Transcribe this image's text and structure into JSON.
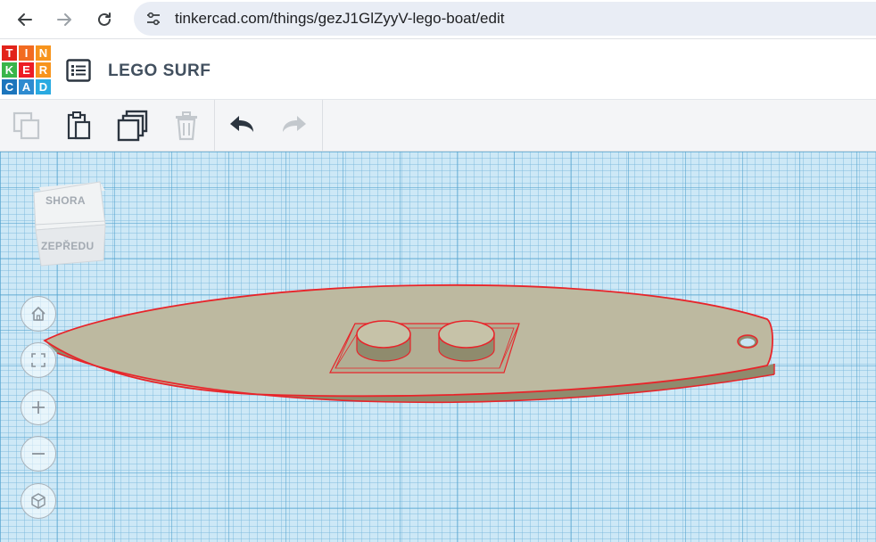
{
  "browser": {
    "url": "tinkercad.com/things/gezJ1GlZyyV-lego-boat/edit",
    "icons": [
      "back-arrow-icon",
      "forward-arrow-icon",
      "reload-icon",
      "site-settings-icon"
    ]
  },
  "app": {
    "logo_letters": [
      "T",
      "I",
      "N",
      "K",
      "E",
      "R",
      "C",
      "A",
      "D"
    ],
    "logo_colors": [
      "#e2231a",
      "#f26b21",
      "#f7941d",
      "#39b54a",
      "#ed1c24",
      "#f7941d",
      "#1c75bc",
      "#2e8bd0",
      "#29aae1"
    ],
    "design_title": "LEGO SURF"
  },
  "toolbar": {
    "tools": [
      "copy-icon",
      "paste-icon",
      "duplicate-icon",
      "delete-icon",
      "undo-icon",
      "redo-icon"
    ]
  },
  "view_cube": {
    "top_label": "SHORA",
    "front_label": "ZEPŘEDU"
  },
  "controls": [
    "home-view-icon",
    "fit-view-icon",
    "zoom-in-icon",
    "zoom-out-icon",
    "ortho-view-icon"
  ],
  "colors": {
    "grid_bg": "#cde8f6",
    "board_fill": "#bdb9a0",
    "board_side": "#8f8b6d",
    "selection": "#e8242a"
  }
}
